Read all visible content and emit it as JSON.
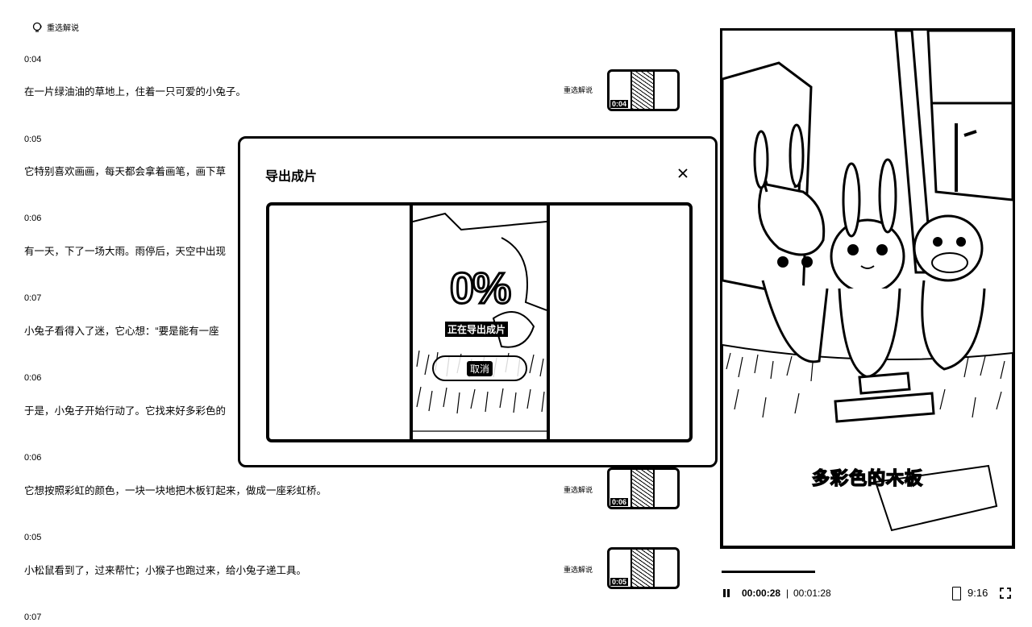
{
  "header": {
    "label": "重选解说"
  },
  "segments": [
    {
      "time": "0:04",
      "text": "在一片绿油油的草地上，住着一只可爱的小兔子。",
      "narration": "重选解说",
      "thumb_time": "0:04"
    },
    {
      "time": "0:05",
      "text": "它特别喜欢画画，每天都会拿着画笔，画下草"
    },
    {
      "time": "0:06",
      "text": "有一天，下了一场大雨。雨停后，天空中出现"
    },
    {
      "time": "0:07",
      "text": "小兔子看得入了迷，它心想：“要是能有一座"
    },
    {
      "time": "0:06",
      "text": "于是，小兔子开始行动了。它找来好多彩色的"
    },
    {
      "time": "0:06",
      "text": "它想按照彩虹的颜色，一块一块地把木板钉起来，做成一座彩虹桥。",
      "narration": "重选解说",
      "thumb_time": "0:06"
    },
    {
      "time": "0:05",
      "text": "小松鼠看到了，过来帮忙；小猴子也跑过来，给小兔子递工具。",
      "narration": "重选解说",
      "thumb_time": "0:05"
    },
    {
      "time": "0:07",
      "text": ""
    }
  ],
  "modal": {
    "title": "导出成片",
    "progress_percent": "0%",
    "progress_value": 0,
    "status": "正在导出成片",
    "cancel_label": "取消"
  },
  "player": {
    "subtitle": "多彩色的木板",
    "current_time": "00:00:28",
    "separator": "|",
    "total_time": "00:01:28",
    "progress_fraction": 0.32,
    "aspect_ratio": "9:16"
  }
}
